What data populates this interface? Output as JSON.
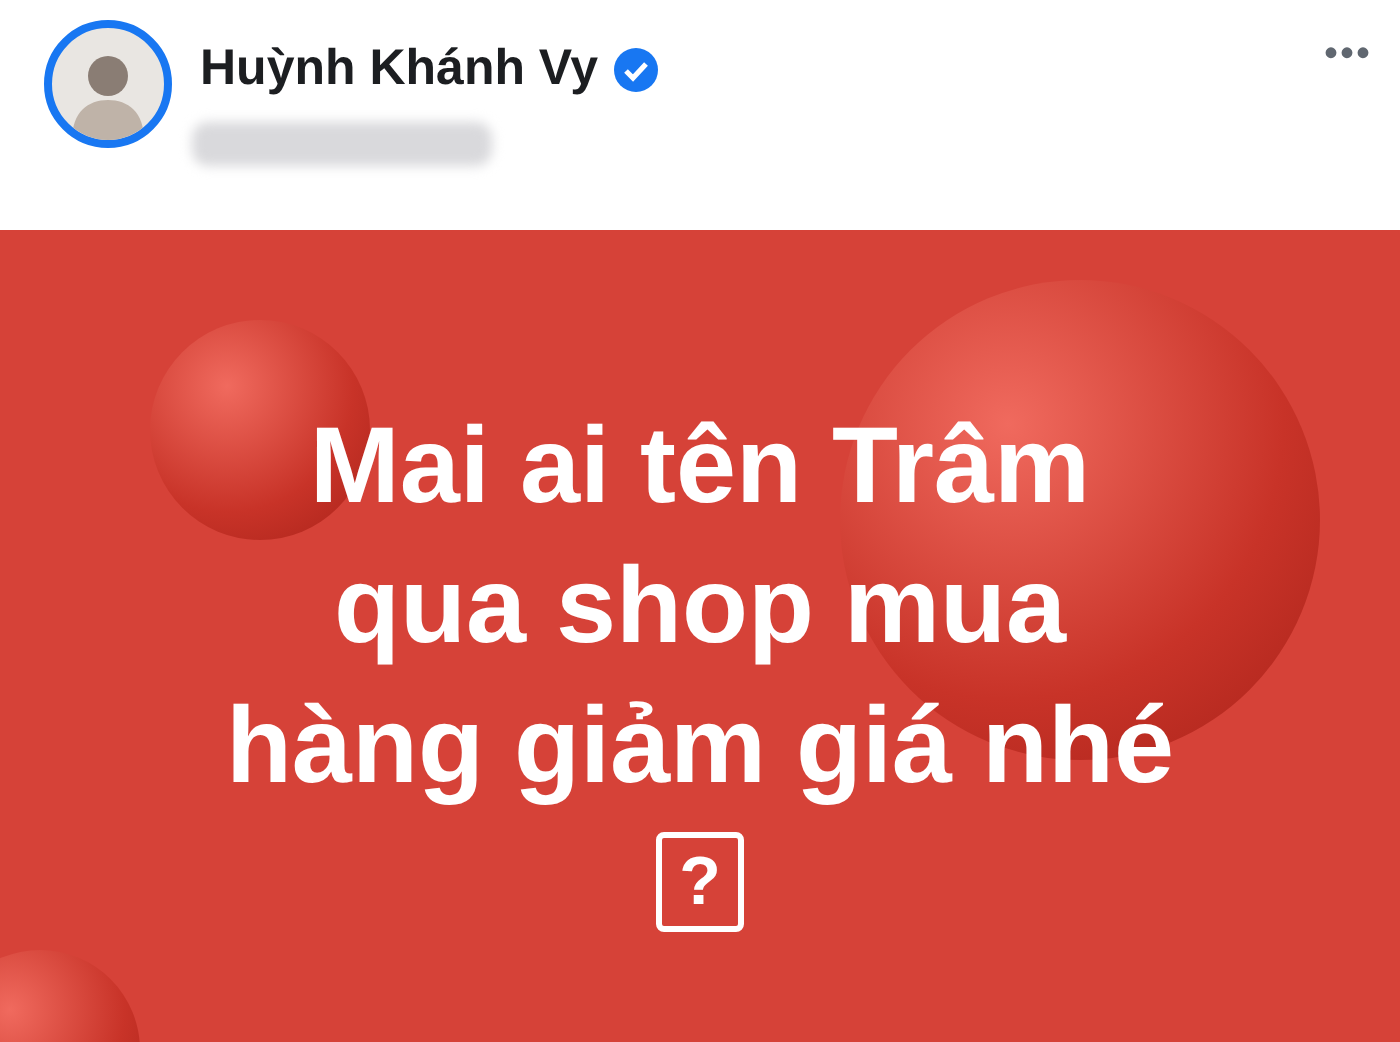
{
  "post": {
    "author": "Huỳnh Khánh Vy",
    "verified": true,
    "menu": "•••",
    "text_lines": [
      "Mai ai tên Trâm",
      "qua shop mua",
      "hàng giảm giá nhé"
    ],
    "emoji": "?"
  }
}
